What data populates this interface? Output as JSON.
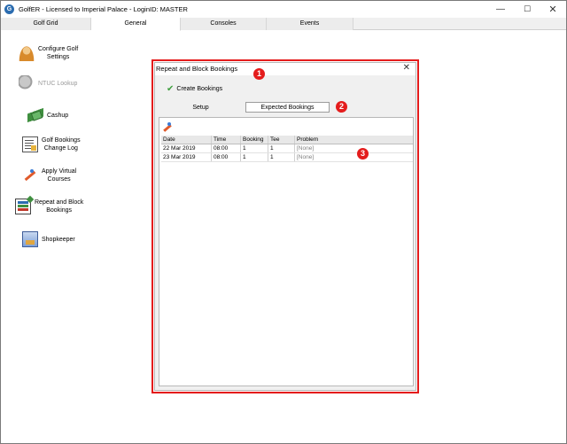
{
  "window": {
    "title": "GolfER - Licensed to Imperial Palace - LoginID: MASTER",
    "minimize": "—",
    "maximize": "☐",
    "close": "✕"
  },
  "tabs": [
    {
      "label": "Golf Grid"
    },
    {
      "label": "General"
    },
    {
      "label": "Consoles"
    },
    {
      "label": "Events"
    }
  ],
  "menu": [
    {
      "label": "Configure Golf\nSettings",
      "icon": "person-golf-icon"
    },
    {
      "label": "NTUC Lookup",
      "icon": "ntuc-icon"
    },
    {
      "label": "Cashup",
      "icon": "cash-icon"
    },
    {
      "label": "Golf Bookings\nChange Log",
      "icon": "change-log-icon"
    },
    {
      "label": "Apply Virtual\nCourses",
      "icon": "virtual-courses-icon"
    },
    {
      "label": "Repeat and Block\nBookings",
      "icon": "repeat-bookings-icon"
    },
    {
      "label": "Shopkeeper",
      "icon": "shopkeeper-icon"
    }
  ],
  "dialog": {
    "title": "Repeat and Block Bookings",
    "close": "✕",
    "create_label": "Create Bookings",
    "segments": {
      "setup": "Setup",
      "expected": "Expected Bookings"
    },
    "table": {
      "headers": [
        "Date",
        "Time",
        "Booking",
        "Tee",
        "Problem"
      ],
      "rows": [
        [
          "22 Mar 2019",
          "08:00",
          "1",
          "1",
          "[None]"
        ],
        [
          "23 Mar 2019",
          "08:00",
          "1",
          "1",
          "[None]"
        ]
      ]
    }
  },
  "annotations": [
    "1",
    "2",
    "3"
  ],
  "colors": {
    "highlight": "#e41c1c",
    "check": "#3f9f3f"
  }
}
